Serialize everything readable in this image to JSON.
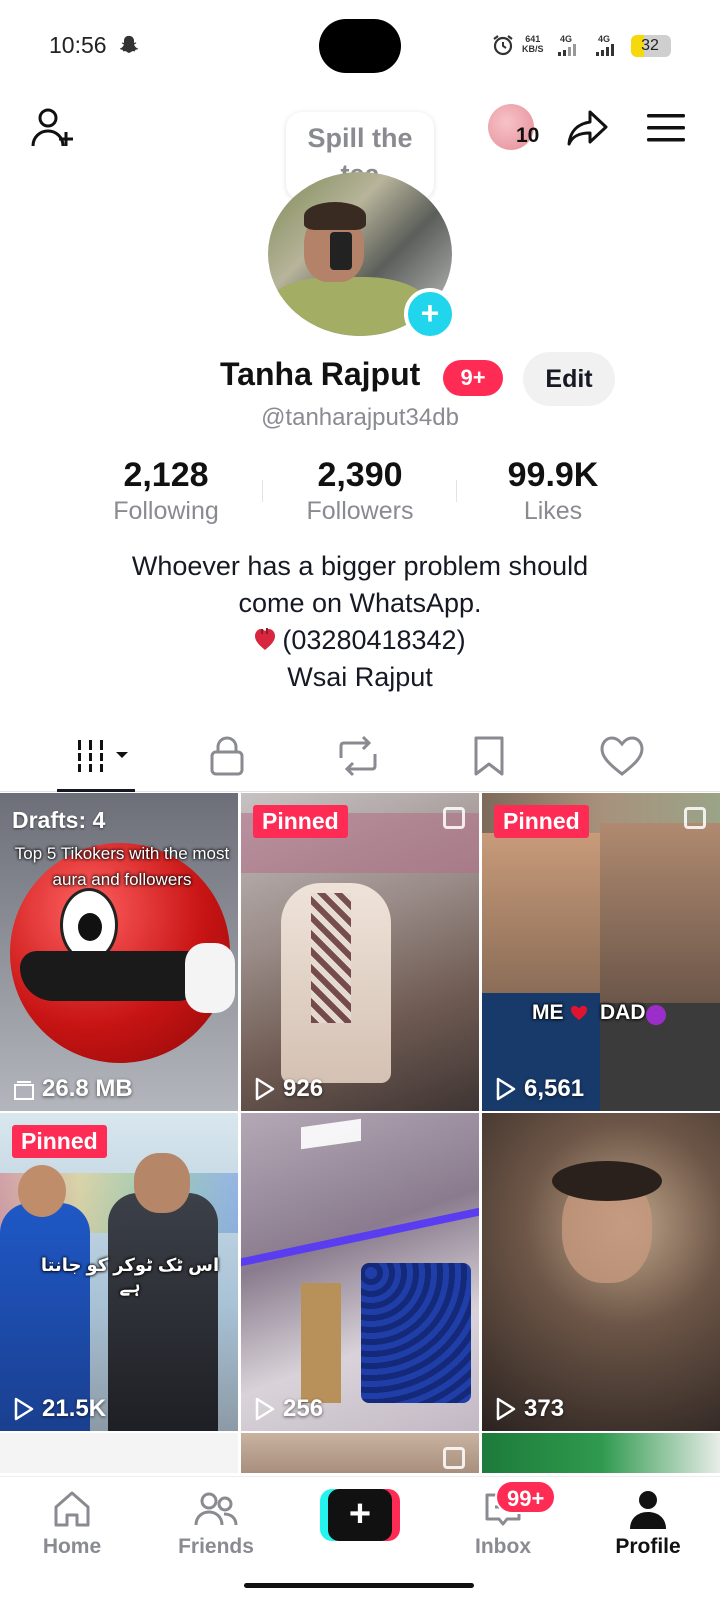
{
  "status_bar": {
    "time": "10:56",
    "net_speed_value": "641",
    "net_speed_unit": "KB/S",
    "signal_1": "4G",
    "signal_2": "4G",
    "battery_level": "32"
  },
  "header": {
    "story_count": "10",
    "icons": [
      "add-friend-icon",
      "share-icon",
      "menu-icon"
    ]
  },
  "note_bubble": {
    "text_line1": "Spill the",
    "text_line2": "tea"
  },
  "profile": {
    "display_name": "Tanha Rajput",
    "notification_badge": "9+",
    "edit_label": "Edit",
    "username": "@tanharajput34db",
    "stats": [
      {
        "value": "2,128",
        "label": "Following"
      },
      {
        "value": "2,390",
        "label": "Followers"
      },
      {
        "value": "99.9K",
        "label": "Likes"
      }
    ],
    "bio_line1": "Whoever has a bigger problem should",
    "bio_line2": "come on WhatsApp.",
    "bio_line3": "(03280418342)",
    "bio_line4": "Wsai Rajput"
  },
  "tabs": [
    "videos-tab",
    "private-tab",
    "reposts-tab",
    "saved-tab",
    "liked-tab"
  ],
  "grid": [
    {
      "kind": "drafts",
      "label": "Drafts: 4",
      "caption": "Top 5 Tikokers with the most aura and followers",
      "footer": "26.8 MB"
    },
    {
      "kind": "pinned",
      "label": "Pinned",
      "views": "926"
    },
    {
      "kind": "pinned",
      "label": "Pinned",
      "views": "6,561",
      "caption_left": "ME",
      "caption_right": "DAD"
    },
    {
      "kind": "pinned",
      "label": "Pinned",
      "views": "21.5K",
      "caption": "اس ٹک ٹوکر کو جانتا ہے"
    },
    {
      "kind": "video",
      "views": "256"
    },
    {
      "kind": "video",
      "views": "373"
    }
  ],
  "bottom_nav": {
    "home": "Home",
    "friends": "Friends",
    "inbox": "Inbox",
    "inbox_badge": "99+",
    "profile": "Profile"
  },
  "colors": {
    "accent_red": "#fe2c55",
    "accent_cyan": "#25f4ee",
    "plus_blue": "#20d5ec",
    "battery_yellow": "#f5d90a"
  }
}
